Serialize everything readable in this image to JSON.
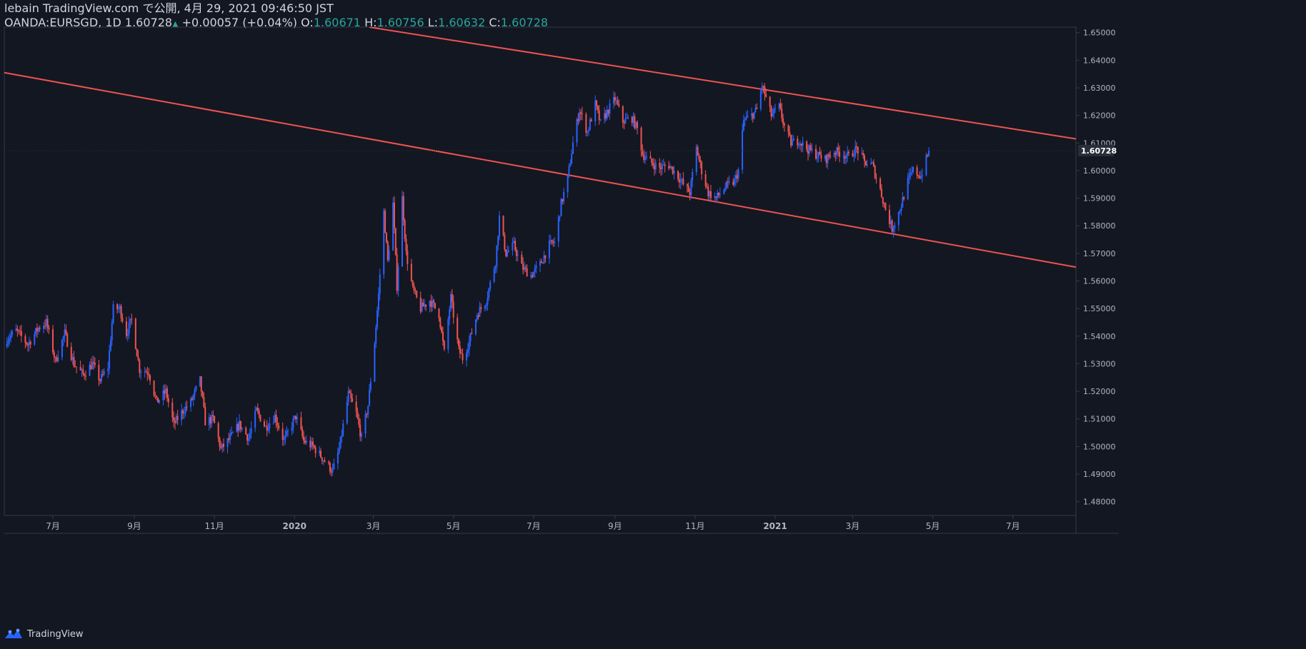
{
  "header": {
    "publisher_line": "lebain TradingView.com で公開, 4月 29, 2021 09:46:50 JST",
    "symbol": "OANDA:EURSGD, 1D",
    "last": "1.60728",
    "change": "+0.00057 (+0.04%)",
    "o_label": "O:",
    "o_value": "1.60671",
    "h_label": "H:",
    "h_value": "1.60756",
    "l_label": "L:",
    "l_value": "1.60632",
    "c_label": "C:",
    "c_value": "1.60728"
  },
  "brand": {
    "name": "TradingView",
    "icon": "tradingview-logo-icon"
  },
  "colors": {
    "background": "#131722",
    "up": "#2962ff",
    "down": "#ef5350",
    "trendline": "#ef5350",
    "axis_text": "#b2b5be",
    "axis_line": "#363a45",
    "last_price_label_bg": "#2a2e39"
  },
  "chart_data": {
    "type": "candlestick",
    "symbol": "OANDA:EURSGD",
    "interval": "1D",
    "ylim": [
      1.475,
      1.652
    ],
    "y_ticks": [
      "1.65000",
      "1.64000",
      "1.63000",
      "1.62000",
      "1.61000",
      "1.60000",
      "1.59000",
      "1.58000",
      "1.57000",
      "1.56000",
      "1.55000",
      "1.54000",
      "1.53000",
      "1.52000",
      "1.51000",
      "1.50000",
      "1.49000",
      "1.48000"
    ],
    "x_ticks": [
      {
        "label": "7月",
        "date": "2019-07-01"
      },
      {
        "label": "9月",
        "date": "2019-09-01"
      },
      {
        "label": "11月",
        "date": "2019-11-01"
      },
      {
        "label": "2020",
        "date": "2020-01-01"
      },
      {
        "label": "3月",
        "date": "2020-03-01"
      },
      {
        "label": "5月",
        "date": "2020-05-01"
      },
      {
        "label": "7月",
        "date": "2020-07-01"
      },
      {
        "label": "9月",
        "date": "2020-09-01"
      },
      {
        "label": "11月",
        "date": "2020-11-01"
      },
      {
        "label": "2021",
        "date": "2021-01-01"
      },
      {
        "label": "3月",
        "date": "2021-03-01"
      },
      {
        "label": "5月",
        "date": "2021-05-01"
      },
      {
        "label": "7月",
        "date": "2021-07-01"
      }
    ],
    "xlim": [
      "2019-05-25",
      "2021-08-18"
    ],
    "last_price": "1.60728",
    "close_path": [
      [
        "2019-05-27",
        1.539
      ],
      [
        "2019-06-03",
        1.542
      ],
      [
        "2019-06-12",
        1.537
      ],
      [
        "2019-06-20",
        1.543
      ],
      [
        "2019-06-26",
        1.545
      ],
      [
        "2019-07-03",
        1.531
      ],
      [
        "2019-07-10",
        1.541
      ],
      [
        "2019-07-17",
        1.53
      ],
      [
        "2019-07-24",
        1.526
      ],
      [
        "2019-07-31",
        1.53
      ],
      [
        "2019-08-06",
        1.524
      ],
      [
        "2019-08-12",
        1.529
      ],
      [
        "2019-08-16",
        1.55
      ],
      [
        "2019-08-21",
        1.55
      ],
      [
        "2019-08-26",
        1.541
      ],
      [
        "2019-08-30",
        1.546
      ],
      [
        "2019-09-05",
        1.528
      ],
      [
        "2019-09-12",
        1.527
      ],
      [
        "2019-09-18",
        1.516
      ],
      [
        "2019-09-25",
        1.52
      ],
      [
        "2019-10-01",
        1.508
      ],
      [
        "2019-10-08",
        1.513
      ],
      [
        "2019-10-14",
        1.516
      ],
      [
        "2019-10-21",
        1.524
      ],
      [
        "2019-10-25",
        1.509
      ],
      [
        "2019-10-31",
        1.51
      ],
      [
        "2019-11-06",
        1.499
      ],
      [
        "2019-11-13",
        1.503
      ],
      [
        "2019-11-20",
        1.508
      ],
      [
        "2019-11-27",
        1.503
      ],
      [
        "2019-12-03",
        1.513
      ],
      [
        "2019-12-10",
        1.507
      ],
      [
        "2019-12-17",
        1.511
      ],
      [
        "2019-12-24",
        1.502
      ],
      [
        "2020-01-02",
        1.511
      ],
      [
        "2020-01-08",
        1.502
      ],
      [
        "2020-01-15",
        1.5
      ],
      [
        "2020-01-22",
        1.496
      ],
      [
        "2020-01-30",
        1.491
      ],
      [
        "2020-02-04",
        1.499
      ],
      [
        "2020-02-11",
        1.519
      ],
      [
        "2020-02-17",
        1.512
      ],
      [
        "2020-02-21",
        1.503
      ],
      [
        "2020-02-26",
        1.515
      ],
      [
        "2020-03-02",
        1.538
      ],
      [
        "2020-03-05",
        1.555
      ],
      [
        "2020-03-09",
        1.585
      ],
      [
        "2020-03-12",
        1.567
      ],
      [
        "2020-03-16",
        1.588
      ],
      [
        "2020-03-19",
        1.558
      ],
      [
        "2020-03-23",
        1.59
      ],
      [
        "2020-03-26",
        1.57
      ],
      [
        "2020-03-31",
        1.557
      ],
      [
        "2020-04-06",
        1.55
      ],
      [
        "2020-04-13",
        1.553
      ],
      [
        "2020-04-20",
        1.548
      ],
      [
        "2020-04-24",
        1.534
      ],
      [
        "2020-04-29",
        1.554
      ],
      [
        "2020-05-05",
        1.535
      ],
      [
        "2020-05-08",
        1.532
      ],
      [
        "2020-05-13",
        1.538
      ],
      [
        "2020-05-19",
        1.548
      ],
      [
        "2020-05-26",
        1.553
      ],
      [
        "2020-06-02",
        1.567
      ],
      [
        "2020-06-05",
        1.583
      ],
      [
        "2020-06-10",
        1.57
      ],
      [
        "2020-06-16",
        1.573
      ],
      [
        "2020-06-22",
        1.565
      ],
      [
        "2020-06-29",
        1.562
      ],
      [
        "2020-07-06",
        1.566
      ],
      [
        "2020-07-13",
        1.573
      ],
      [
        "2020-07-17",
        1.574
      ],
      [
        "2020-07-22",
        1.588
      ],
      [
        "2020-07-27",
        1.597
      ],
      [
        "2020-07-31",
        1.61
      ],
      [
        "2020-08-05",
        1.622
      ],
      [
        "2020-08-11",
        1.614
      ],
      [
        "2020-08-17",
        1.624
      ],
      [
        "2020-08-21",
        1.617
      ],
      [
        "2020-08-27",
        1.622
      ],
      [
        "2020-09-01",
        1.626
      ],
      [
        "2020-09-07",
        1.618
      ],
      [
        "2020-09-14",
        1.619
      ],
      [
        "2020-09-18",
        1.615
      ],
      [
        "2020-09-22",
        1.606
      ],
      [
        "2020-09-28",
        1.603
      ],
      [
        "2020-10-05",
        1.601
      ],
      [
        "2020-10-12",
        1.602
      ],
      [
        "2020-10-19",
        1.598
      ],
      [
        "2020-10-23",
        1.595
      ],
      [
        "2020-10-28",
        1.592
      ],
      [
        "2020-11-02",
        1.608
      ],
      [
        "2020-11-06",
        1.6
      ],
      [
        "2020-11-11",
        1.592
      ],
      [
        "2020-11-17",
        1.59
      ],
      [
        "2020-11-24",
        1.594
      ],
      [
        "2020-12-01",
        1.596
      ],
      [
        "2020-12-04",
        1.6
      ],
      [
        "2020-12-08",
        1.618
      ],
      [
        "2020-12-14",
        1.62
      ],
      [
        "2020-12-18",
        1.622
      ],
      [
        "2020-12-22",
        1.631
      ],
      [
        "2020-12-29",
        1.62
      ],
      [
        "2021-01-04",
        1.623
      ],
      [
        "2021-01-08",
        1.616
      ],
      [
        "2021-01-13",
        1.61
      ],
      [
        "2021-01-19",
        1.611
      ],
      [
        "2021-01-25",
        1.608
      ],
      [
        "2021-02-01",
        1.606
      ],
      [
        "2021-02-08",
        1.604
      ],
      [
        "2021-02-15",
        1.607
      ],
      [
        "2021-02-22",
        1.606
      ],
      [
        "2021-02-26",
        1.605
      ],
      [
        "2021-03-04",
        1.608
      ],
      [
        "2021-03-10",
        1.603
      ],
      [
        "2021-03-16",
        1.602
      ],
      [
        "2021-03-22",
        1.593
      ],
      [
        "2021-03-26",
        1.586
      ],
      [
        "2021-03-31",
        1.579
      ],
      [
        "2021-04-06",
        1.586
      ],
      [
        "2021-04-12",
        1.596
      ],
      [
        "2021-04-16",
        1.6
      ],
      [
        "2021-04-22",
        1.598
      ],
      [
        "2021-04-28",
        1.607
      ]
    ],
    "trendlines": [
      {
        "name": "upper",
        "p1": [
          "2020-02-27",
          1.652
        ],
        "p2": [
          "2021-08-18",
          1.6115
        ]
      },
      {
        "name": "lower",
        "p1": [
          "2019-05-25",
          1.6355
        ],
        "p2": [
          "2021-08-18",
          1.565
        ]
      }
    ]
  }
}
